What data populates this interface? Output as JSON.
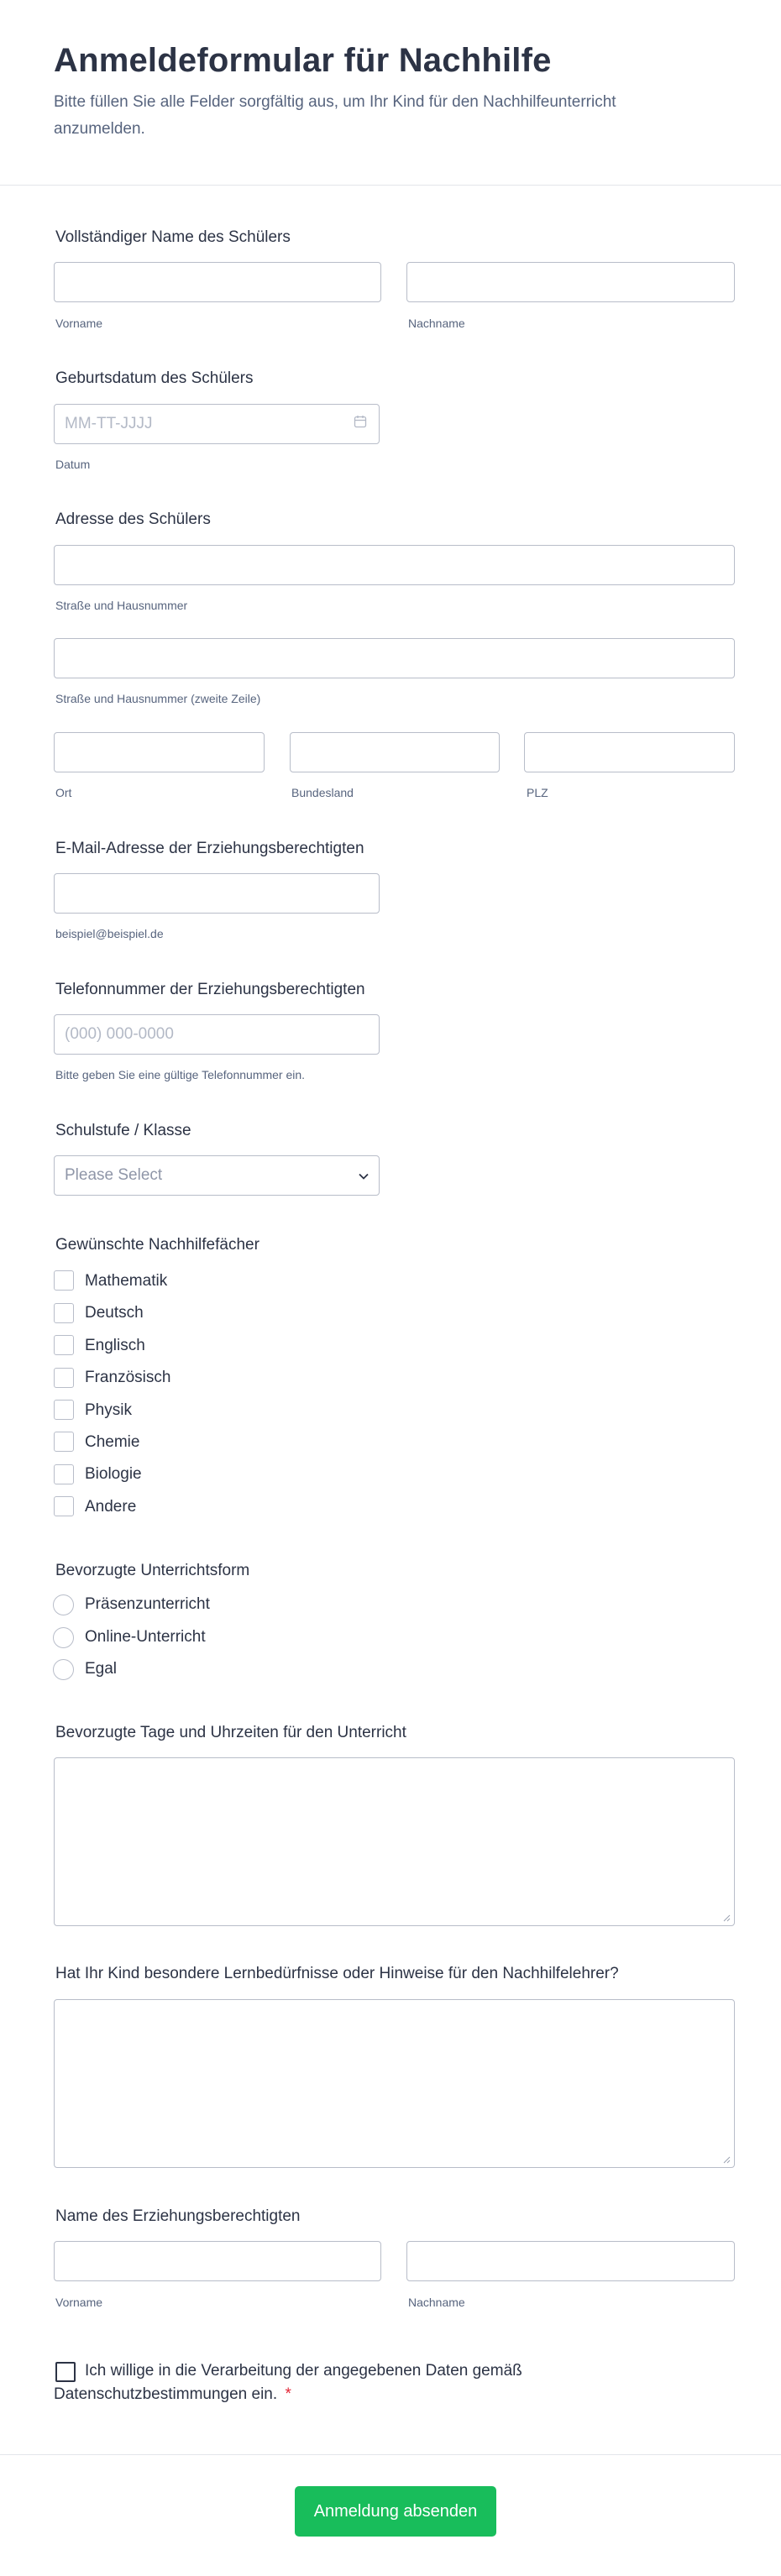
{
  "header": {
    "title": "Anmeldeformular für Nachhilfe",
    "subtitle": "Bitte füllen Sie alle Felder sorgfältig aus, um Ihr Kind für den Nachhilfeunterricht anzumelden."
  },
  "student_name": {
    "label": "Vollständiger Name des Schülers",
    "first_sublabel": "Vorname",
    "last_sublabel": "Nachname"
  },
  "birthdate": {
    "label": "Geburtsdatum des Schülers",
    "placeholder": "MM-TT-JJJJ",
    "sublabel": "Datum",
    "icon": "calendar-icon"
  },
  "address": {
    "label": "Adresse des Schülers",
    "street_sublabel": "Straße und Hausnummer",
    "street2_sublabel": "Straße und Hausnummer (zweite Zeile)",
    "city_sublabel": "Ort",
    "state_sublabel": "Bundesland",
    "zip_sublabel": "PLZ"
  },
  "email": {
    "label": "E-Mail-Adresse der Erziehungsberechtigten",
    "sublabel": "beispiel@beispiel.de"
  },
  "phone": {
    "label": "Telefonnummer der Erziehungsberechtigten",
    "placeholder": "(000) 000-0000",
    "sublabel": "Bitte geben Sie eine gültige Telefonnummer ein."
  },
  "grade": {
    "label": "Schulstufe / Klasse",
    "selected": "Please Select",
    "icon": "chevron-down-icon"
  },
  "subjects": {
    "label": "Gewünschte Nachhilfefächer",
    "options": [
      "Mathematik",
      "Deutsch",
      "Englisch",
      "Französisch",
      "Physik",
      "Chemie",
      "Biologie",
      "Andere"
    ]
  },
  "lesson_form": {
    "label": "Bevorzugte Unterrichtsform",
    "options": [
      "Präsenzunterricht",
      "Online-Unterricht",
      "Egal"
    ]
  },
  "times": {
    "label": "Bevorzugte Tage und Uhrzeiten für den Unterricht"
  },
  "needs": {
    "label": "Hat Ihr Kind besondere Lernbedürfnisse oder Hinweise für den Nachhilfelehrer?"
  },
  "guardian_name": {
    "label": "Name des Erziehungsberechtigten",
    "first_sublabel": "Vorname",
    "last_sublabel": "Nachname"
  },
  "consent": {
    "text": "Ich willige in die Verarbeitung der angegebenen Daten gemäß Datenschutzbestimmungen ein.",
    "required_mark": "*"
  },
  "submit": {
    "label": "Anmeldung absenden",
    "color": "#18bd5b"
  }
}
